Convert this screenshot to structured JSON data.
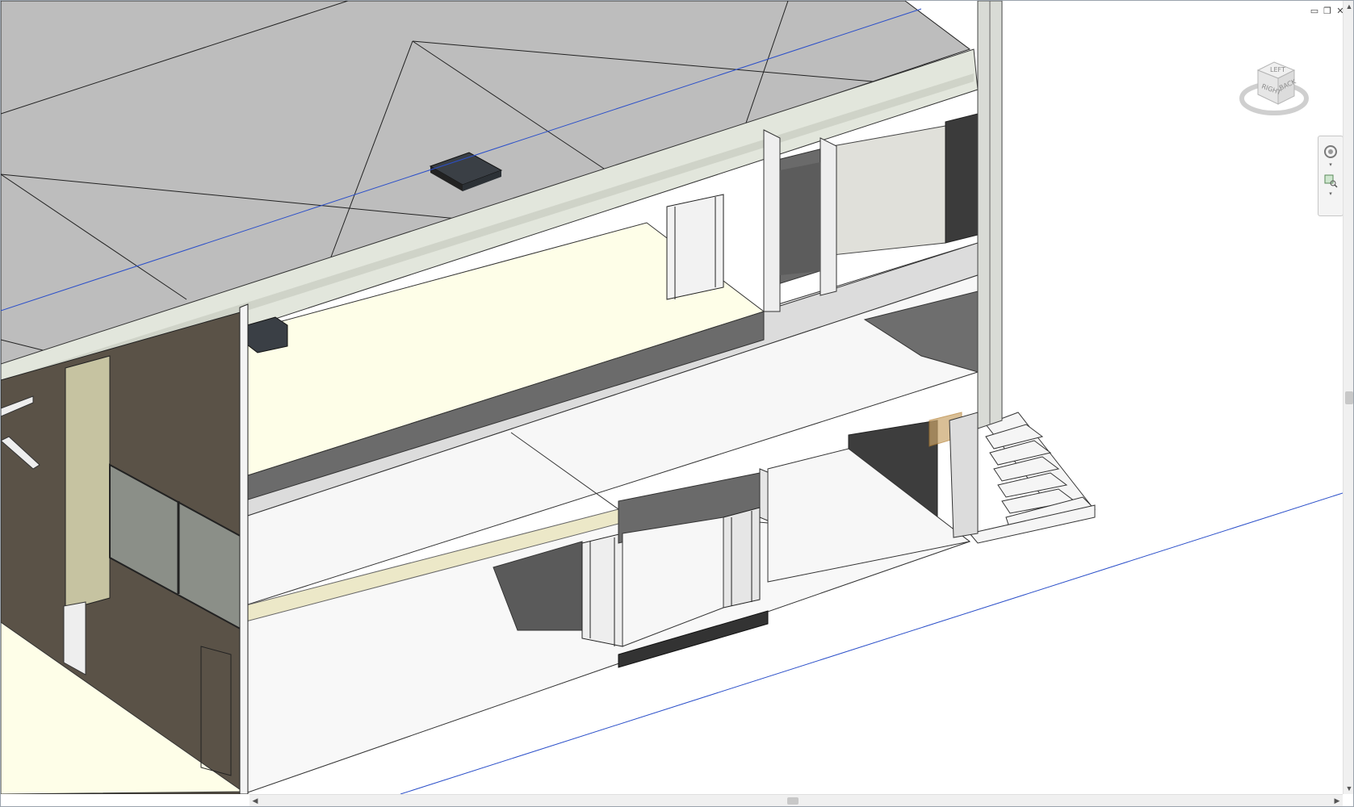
{
  "window": {
    "minimize_icon": "minimize-icon",
    "restore_icon": "restore-icon",
    "close_icon": "close-icon",
    "minimize_glyph": "▭",
    "restore_glyph": "❐",
    "close_glyph": "✕"
  },
  "view_cube": {
    "face_top": "LEFT",
    "face_left": "RIGHT",
    "face_right": "BACK"
  },
  "navigation_bar": {
    "items": [
      "steering-wheel-icon",
      "zoom-region-icon"
    ]
  },
  "scrollbars": {
    "vertical": {
      "up_glyph": "▲",
      "down_glyph": "▼"
    },
    "horizontal": {
      "left_glyph": "◀",
      "right_glyph": "▶"
    }
  },
  "colors": {
    "roof": "#bdbdbd",
    "slab_cut": "#e2e6dc",
    "floor": "#f7f7f7",
    "yellow_floor": "#fefee8",
    "wall_dark": "#5a5247",
    "wall_tan": "#c6c3a1",
    "glazing": "#8b8f88",
    "grid_line": "#2b4fc9",
    "fixture": "#3a3f45"
  }
}
